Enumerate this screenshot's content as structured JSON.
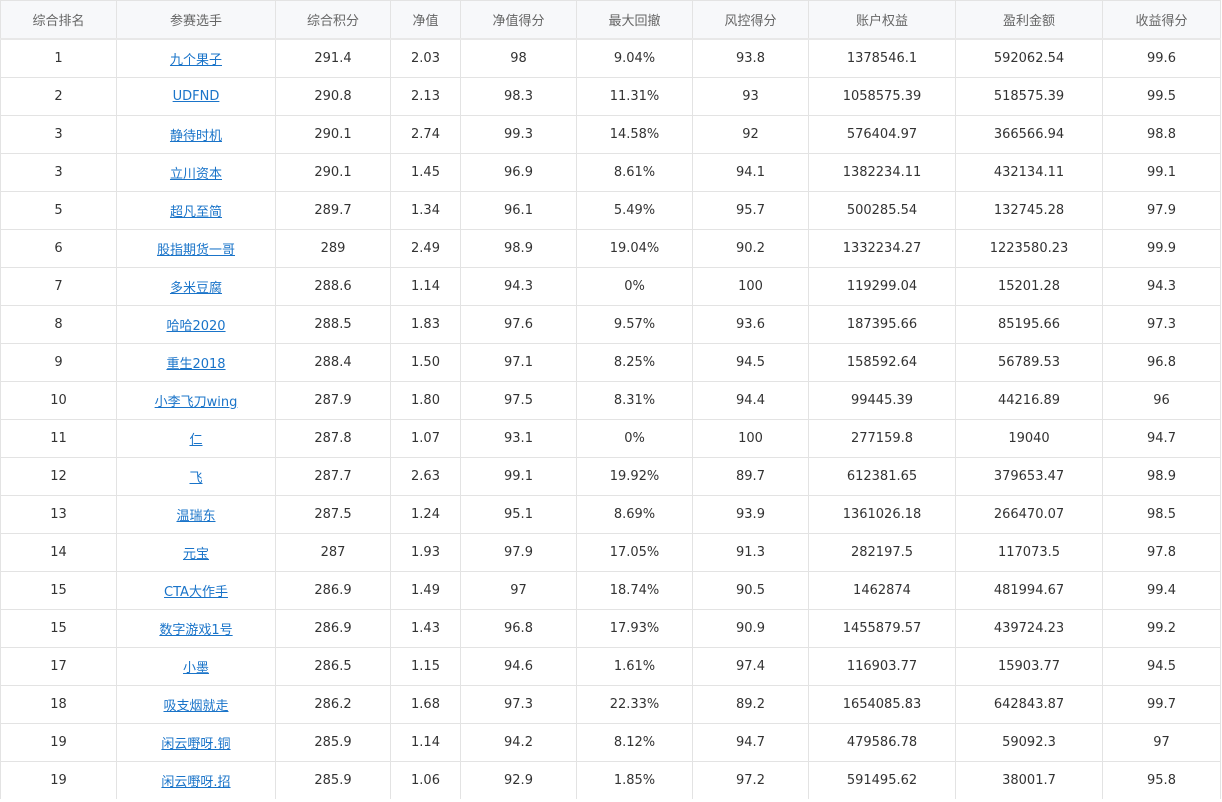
{
  "table": {
    "headers": [
      "综合排名",
      "参赛选手",
      "综合积分",
      "净值",
      "净值得分",
      "最大回撤",
      "风控得分",
      "账户权益",
      "盈利金额",
      "收益得分"
    ],
    "rows": [
      [
        "1",
        "九个果子",
        "291.4",
        "2.03",
        "98",
        "9.04%",
        "93.8",
        "1378546.1",
        "592062.54",
        "99.6"
      ],
      [
        "2",
        "UDFND",
        "290.8",
        "2.13",
        "98.3",
        "11.31%",
        "93",
        "1058575.39",
        "518575.39",
        "99.5"
      ],
      [
        "3",
        "静待时机",
        "290.1",
        "2.74",
        "99.3",
        "14.58%",
        "92",
        "576404.97",
        "366566.94",
        "98.8"
      ],
      [
        "3",
        "立川资本",
        "290.1",
        "1.45",
        "96.9",
        "8.61%",
        "94.1",
        "1382234.11",
        "432134.11",
        "99.1"
      ],
      [
        "5",
        "超凡至简",
        "289.7",
        "1.34",
        "96.1",
        "5.49%",
        "95.7",
        "500285.54",
        "132745.28",
        "97.9"
      ],
      [
        "6",
        "股指期货一哥",
        "289",
        "2.49",
        "98.9",
        "19.04%",
        "90.2",
        "1332234.27",
        "1223580.23",
        "99.9"
      ],
      [
        "7",
        "多米豆腐",
        "288.6",
        "1.14",
        "94.3",
        "0%",
        "100",
        "119299.04",
        "15201.28",
        "94.3"
      ],
      [
        "8",
        "哈哈2020",
        "288.5",
        "1.83",
        "97.6",
        "9.57%",
        "93.6",
        "187395.66",
        "85195.66",
        "97.3"
      ],
      [
        "9",
        "重生2018",
        "288.4",
        "1.50",
        "97.1",
        "8.25%",
        "94.5",
        "158592.64",
        "56789.53",
        "96.8"
      ],
      [
        "10",
        "小李飞刀wing",
        "287.9",
        "1.80",
        "97.5",
        "8.31%",
        "94.4",
        "99445.39",
        "44216.89",
        "96"
      ],
      [
        "11",
        "仁",
        "287.8",
        "1.07",
        "93.1",
        "0%",
        "100",
        "277159.8",
        "19040",
        "94.7"
      ],
      [
        "12",
        "飞",
        "287.7",
        "2.63",
        "99.1",
        "19.92%",
        "89.7",
        "612381.65",
        "379653.47",
        "98.9"
      ],
      [
        "13",
        "温瑞东",
        "287.5",
        "1.24",
        "95.1",
        "8.69%",
        "93.9",
        "1361026.18",
        "266470.07",
        "98.5"
      ],
      [
        "14",
        "元宝",
        "287",
        "1.93",
        "97.9",
        "17.05%",
        "91.3",
        "282197.5",
        "117073.5",
        "97.8"
      ],
      [
        "15",
        "CTA大作手",
        "286.9",
        "1.49",
        "97",
        "18.74%",
        "90.5",
        "1462874",
        "481994.67",
        "99.4"
      ],
      [
        "15",
        "数字游戏1号",
        "286.9",
        "1.43",
        "96.8",
        "17.93%",
        "90.9",
        "1455879.57",
        "439724.23",
        "99.2"
      ],
      [
        "17",
        "小墨",
        "286.5",
        "1.15",
        "94.6",
        "1.61%",
        "97.4",
        "116903.77",
        "15903.77",
        "94.5"
      ],
      [
        "18",
        "吸支烟就走",
        "286.2",
        "1.68",
        "97.3",
        "22.33%",
        "89.2",
        "1654085.83",
        "642843.87",
        "99.7"
      ],
      [
        "19",
        "闲云嘢呀.铜",
        "285.9",
        "1.14",
        "94.2",
        "8.12%",
        "94.7",
        "479586.78",
        "59092.3",
        "97"
      ],
      [
        "19",
        "闲云嘢呀.招",
        "285.9",
        "1.06",
        "92.9",
        "1.85%",
        "97.2",
        "591495.62",
        "38001.7",
        "95.8"
      ]
    ]
  },
  "colors": {
    "link": "#1a74c9",
    "header_bg": "#f7f8fa",
    "border": "#e3e3e3"
  }
}
